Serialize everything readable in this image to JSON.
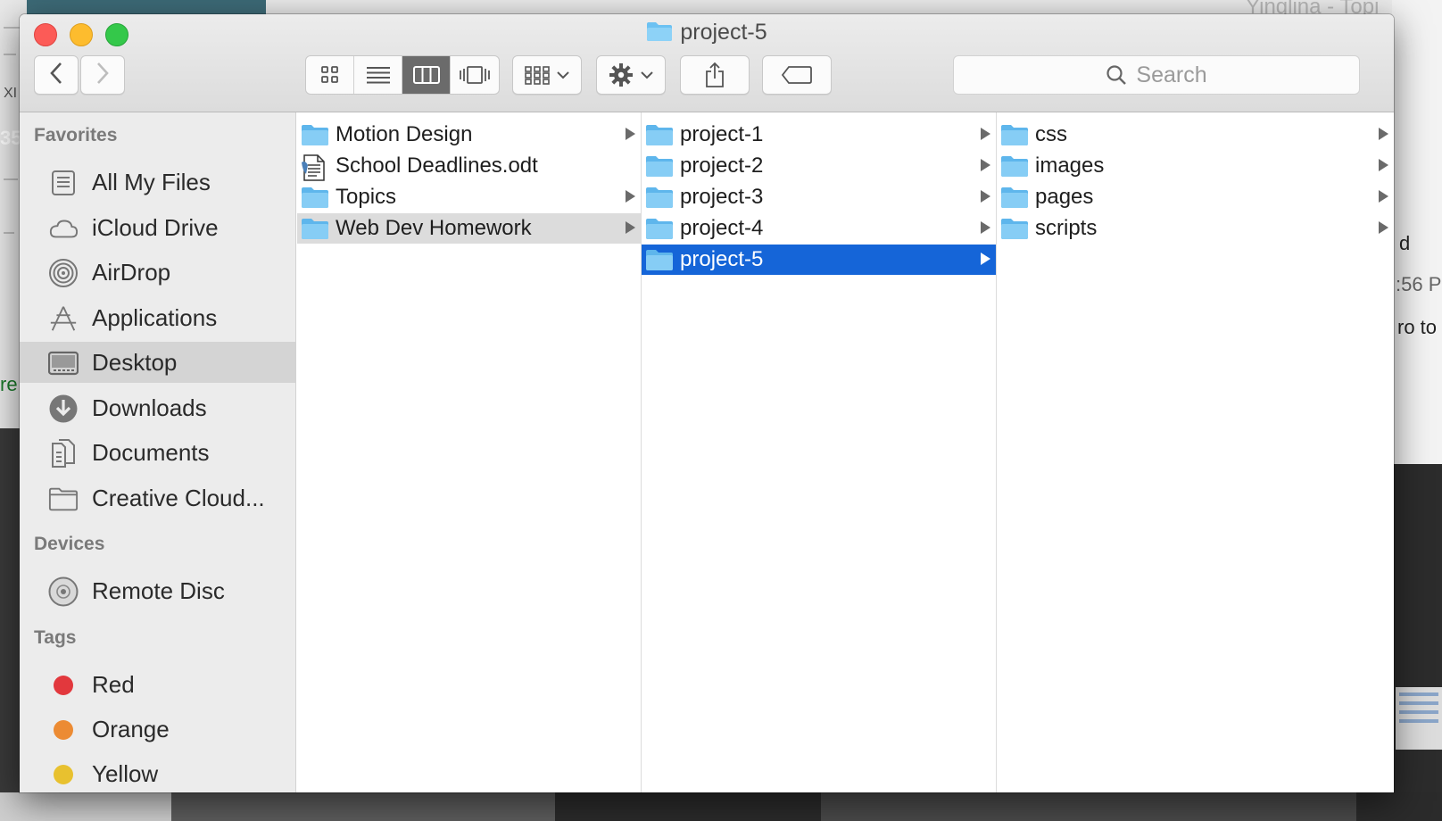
{
  "background": {
    "right_title": "Yinglina - Topi",
    "fragments": [
      "XI",
      "35",
      "re",
      "d",
      ":56 P",
      "ro to"
    ]
  },
  "window": {
    "title": "project-5",
    "search_placeholder": "Search"
  },
  "toolbar": {
    "back_icon": "chevron-left-icon",
    "forward_icon": "chevron-right-icon",
    "view_modes": [
      "icon-view",
      "list-view",
      "column-view",
      "cover-flow-view"
    ],
    "active_view": "column-view"
  },
  "sidebar": {
    "favorites_header": "Favorites",
    "favorites": [
      {
        "label": "All My Files",
        "icon": "all-files-icon"
      },
      {
        "label": "iCloud Drive",
        "icon": "cloud-icon"
      },
      {
        "label": "AirDrop",
        "icon": "airdrop-icon"
      },
      {
        "label": "Applications",
        "icon": "applications-icon"
      },
      {
        "label": "Desktop",
        "icon": "desktop-icon",
        "selected": true
      },
      {
        "label": "Downloads",
        "icon": "downloads-icon"
      },
      {
        "label": "Documents",
        "icon": "documents-icon"
      },
      {
        "label": "Creative Cloud...",
        "icon": "folder-icon"
      }
    ],
    "devices_header": "Devices",
    "devices": [
      {
        "label": "Remote Disc",
        "icon": "disc-icon"
      }
    ],
    "tags_header": "Tags",
    "tags": [
      {
        "label": "Red",
        "color": "#e2383d"
      },
      {
        "label": "Orange",
        "color": "#ec8b33"
      },
      {
        "label": "Yellow",
        "color": "#e8c12f"
      }
    ]
  },
  "columns": {
    "col1": [
      {
        "name": "Motion Design",
        "type": "folder",
        "has_children": true
      },
      {
        "name": "School Deadlines.odt",
        "type": "document",
        "has_children": false
      },
      {
        "name": "Topics",
        "type": "folder",
        "has_children": true
      },
      {
        "name": "Web Dev Homework",
        "type": "folder",
        "has_children": true,
        "selected": "inactive"
      }
    ],
    "col2": [
      {
        "name": "project-1",
        "type": "folder",
        "has_children": true
      },
      {
        "name": "project-2",
        "type": "folder",
        "has_children": true
      },
      {
        "name": "project-3",
        "type": "folder",
        "has_children": true
      },
      {
        "name": "project-4",
        "type": "folder",
        "has_children": true
      },
      {
        "name": "project-5",
        "type": "folder",
        "has_children": true,
        "selected": "active"
      }
    ],
    "col3": [
      {
        "name": "css",
        "type": "folder",
        "has_children": true
      },
      {
        "name": "images",
        "type": "folder",
        "has_children": true
      },
      {
        "name": "pages",
        "type": "folder",
        "has_children": true
      },
      {
        "name": "scripts",
        "type": "folder",
        "has_children": true
      }
    ]
  },
  "colors": {
    "selection_blue": "#1565d8",
    "folder_blue": "#6cc1f2",
    "sidebar_bg": "#ececec"
  }
}
